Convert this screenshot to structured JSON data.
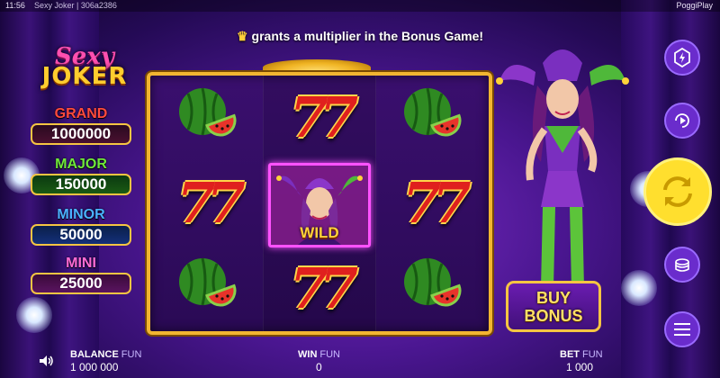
{
  "status_bar": {
    "time": "11:56",
    "title": "Sexy Joker | 306a2386",
    "provider": "PoggiPlay"
  },
  "banner": {
    "text": "grants a multiplier in the Bonus Game!"
  },
  "logo": {
    "line1": "Sexy",
    "line2": "JOKER"
  },
  "jackpots": [
    {
      "label": "GRAND",
      "value": "1000000"
    },
    {
      "label": "MAJOR",
      "value": "150000"
    },
    {
      "label": "MINOR",
      "value": "50000"
    },
    {
      "label": "MINI",
      "value": "25000"
    }
  ],
  "reels": {
    "symbols": [
      [
        "watermelon",
        "seven",
        "watermelon"
      ],
      [
        "seven",
        "wild",
        "seven"
      ],
      [
        "watermelon",
        "seven",
        "watermelon"
      ]
    ],
    "seven_text": "77",
    "wild_label": "WILD"
  },
  "buy_bonus": {
    "line1": "BUY",
    "line2": "BONUS"
  },
  "controls": [
    "lightning-icon",
    "autoplay-icon",
    "spin-icon",
    "coins-stack-icon",
    "menu-icon"
  ],
  "bottom_bar": {
    "balance_label": "BALANCE",
    "balance_unit": "FUN",
    "balance_value": "1 000 000",
    "win_label": "WIN",
    "win_unit": "FUN",
    "win_value": "0",
    "bet_label": "BET",
    "bet_unit": "FUN",
    "bet_value": "1 000"
  },
  "colors": {
    "frame_gold": "#f2b531",
    "wild_border": "#ff52ff",
    "spin_yellow": "#ffdf2e",
    "control_purple": "#6a2ccc"
  }
}
